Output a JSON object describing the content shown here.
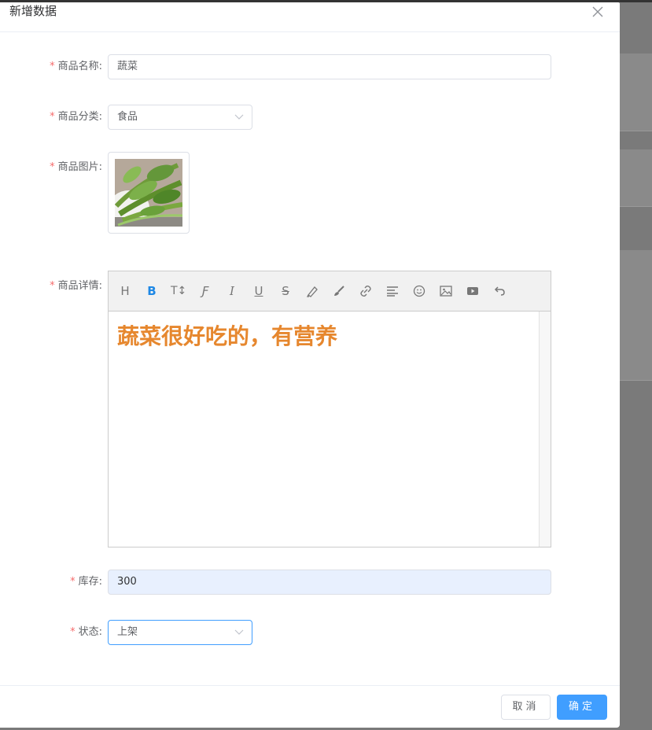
{
  "dialog": {
    "title": "新增数据",
    "close_icon": "close-icon"
  },
  "form": {
    "name": {
      "label": "商品名称:",
      "value": "蔬菜"
    },
    "category": {
      "label": "商品分类:",
      "value": "食品"
    },
    "image": {
      "label": "商品图片:"
    },
    "detail": {
      "label": "商品详情:",
      "content": "蔬菜很好吃的，有营养"
    },
    "stock": {
      "label": "库存:",
      "value": "300"
    },
    "status": {
      "label": "状态:",
      "value": "上架"
    },
    "required_mark": "*"
  },
  "editor_toolbar": {
    "heading": "H",
    "bold": "B",
    "font_size": "T↕",
    "font_name": "Ƒ",
    "italic": "I",
    "underline": "U",
    "strike": "S"
  },
  "footer": {
    "cancel": "取消",
    "confirm": "确定"
  },
  "colors": {
    "primary": "#409eff",
    "required": "#f56c6c",
    "editor_text": "#e6872e",
    "overlay": "#7a7a7a"
  }
}
